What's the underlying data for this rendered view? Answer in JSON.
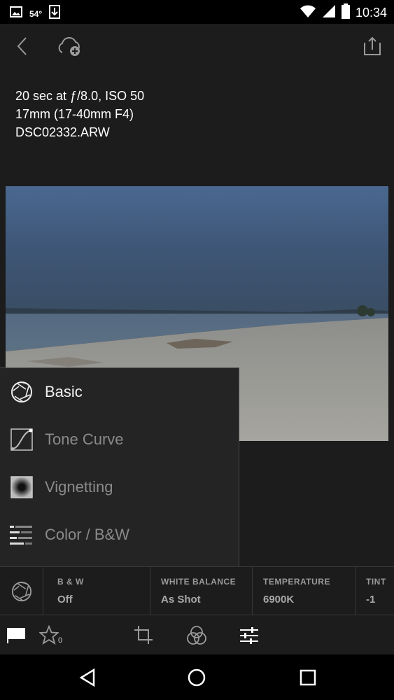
{
  "status_bar": {
    "temperature": "54°",
    "time": "10:34",
    "icons": [
      "image-icon",
      "download-icon",
      "wifi-icon",
      "signal-icon",
      "battery-icon"
    ]
  },
  "top_bar": {
    "icons": [
      "back-icon",
      "cloud-add-icon",
      "share-icon"
    ]
  },
  "exif": {
    "exposure": "20 sec at ƒ/8.0, ISO 50",
    "lens": "17mm (17-40mm F4)",
    "filename": "DSC02332.ARW"
  },
  "panel_menu": {
    "items": [
      {
        "label": "Basic",
        "icon": "aperture-icon",
        "active": true
      },
      {
        "label": "Tone Curve",
        "icon": "tone-curve-icon",
        "active": false
      },
      {
        "label": "Vignetting",
        "icon": "vignette-icon",
        "active": false
      },
      {
        "label": "Color / B&W",
        "icon": "color-bw-icon",
        "active": false
      }
    ]
  },
  "settings_strip": {
    "icon": "aperture-icon",
    "cells": [
      {
        "label": "B & W",
        "value": "Off"
      },
      {
        "label": "WHITE BALANCE",
        "value": "As Shot"
      },
      {
        "label": "TEMPERATURE",
        "value": "6900K"
      },
      {
        "label": "TINT",
        "value": "-1"
      }
    ]
  },
  "toolbar": {
    "rating_count": "0",
    "icons": [
      "flag-icon",
      "star-icon",
      "crop-icon",
      "presets-icon",
      "adjust-sliders-icon"
    ]
  },
  "nav_bar": {
    "icons": [
      "nav-back-icon",
      "nav-home-icon",
      "nav-recents-icon"
    ]
  }
}
